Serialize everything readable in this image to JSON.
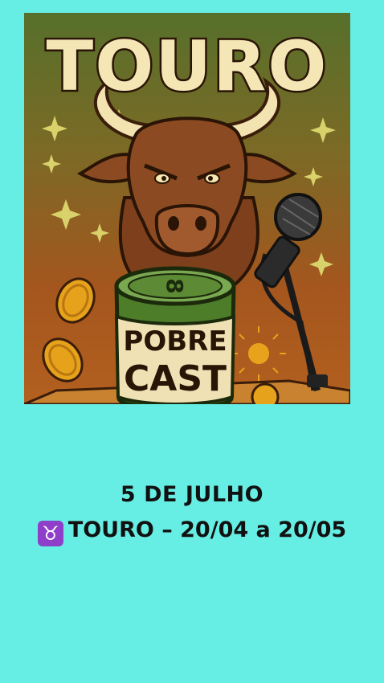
{
  "cover": {
    "title": "TOURO",
    "can_line1": "POBRE",
    "can_line2": "CAST",
    "can_logo": "8",
    "icons": [
      "bull-icon",
      "microphone-icon",
      "coin-icon",
      "sparkle-icon",
      "sun-icon",
      "beer-can-icon"
    ],
    "colors": {
      "bg_top": "#5a6e2a",
      "bg_bottom": "#a4521d",
      "bull": "#8b4a22",
      "can": "#4e7d2a",
      "coin": "#e6a21a"
    }
  },
  "caption": {
    "date": "5 DE JULHO",
    "sign_symbol": "♉",
    "sign_text": "TOURO – 20/04 a 20/05"
  },
  "colors": {
    "page_bg": "#67eee4",
    "text": "#111111",
    "sign_badge": "#8e3ec9"
  }
}
